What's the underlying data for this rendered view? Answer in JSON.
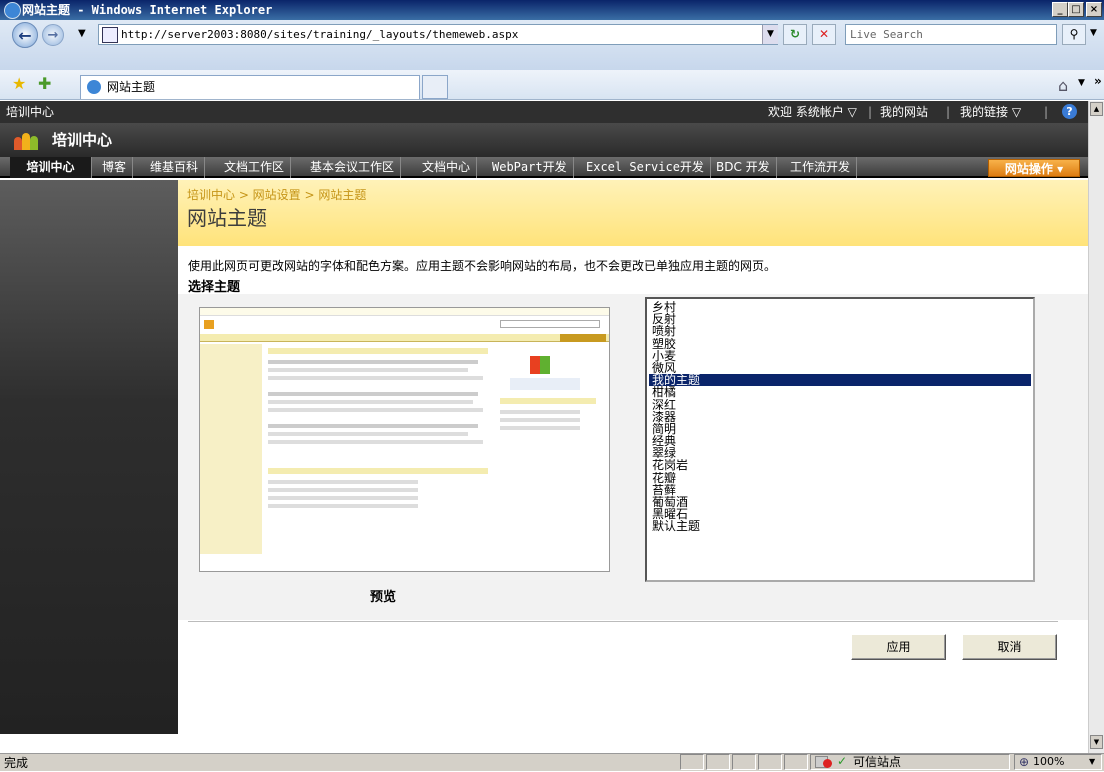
{
  "window": {
    "title": "网站主题 - Windows Internet Explorer",
    "minimize": "_",
    "maximize": "□",
    "close": "×"
  },
  "browser": {
    "url": "http://server2003:8080/sites/training/_layouts/themeweb.aspx",
    "search_placeholder": "Live Search",
    "tab_title": "网站主题",
    "status_text": "完成",
    "zone_text": "可信站点",
    "zoom": "100%"
  },
  "sharepoint": {
    "site_name_top": "培训中心",
    "welcome": "欢迎 系统帐户 ▽",
    "my_site": "我的网站",
    "my_links": "我的链接 ▽",
    "site_title": "培训中心",
    "site_actions": "网站操作 ▾",
    "nav": [
      {
        "label": "培训中心"
      },
      {
        "label": "博客"
      },
      {
        "label": "维基百科"
      },
      {
        "label": "文档工作区"
      },
      {
        "label": "基本会议工作区"
      },
      {
        "label": "文档中心"
      },
      {
        "label": "WebPart开发"
      },
      {
        "label": "Excel Service开发"
      },
      {
        "label": "BDC 开发"
      },
      {
        "label": "工作流开发"
      }
    ]
  },
  "page": {
    "breadcrumb": "培训中心 > 网站设置 > 网站主题",
    "title": "网站主题",
    "description": "使用此网页可更改网站的字体和配色方案。应用主题不会影响网站的布局，也不会更改已单独应用主题的网页。",
    "choose_label": "选择主题",
    "preview_label": "预览",
    "apply": "应用",
    "cancel": "取消"
  },
  "themes": [
    {
      "name": "乡村",
      "selected": false
    },
    {
      "name": "反射",
      "selected": false
    },
    {
      "name": "喷射",
      "selected": false
    },
    {
      "name": "塑胶",
      "selected": false
    },
    {
      "name": "小麦",
      "selected": false
    },
    {
      "name": "微风",
      "selected": false
    },
    {
      "name": "我的主题",
      "selected": true
    },
    {
      "name": "柑橘",
      "selected": false
    },
    {
      "name": "深红",
      "selected": false
    },
    {
      "name": "漆器",
      "selected": false
    },
    {
      "name": "简明",
      "selected": false
    },
    {
      "name": "经典",
      "selected": false
    },
    {
      "name": "翠绿",
      "selected": false
    },
    {
      "name": "花岗岩",
      "selected": false
    },
    {
      "name": "花瓣",
      "selected": false
    },
    {
      "name": "苔藓",
      "selected": false
    },
    {
      "name": "葡萄酒",
      "selected": false
    },
    {
      "name": "黑曜石",
      "selected": false
    },
    {
      "name": "默认主题",
      "selected": false
    }
  ],
  "colors": {
    "accent_orange": "#e08a1e",
    "title_yellow": "#ffe37a",
    "selected_blue": "#0a246a"
  }
}
